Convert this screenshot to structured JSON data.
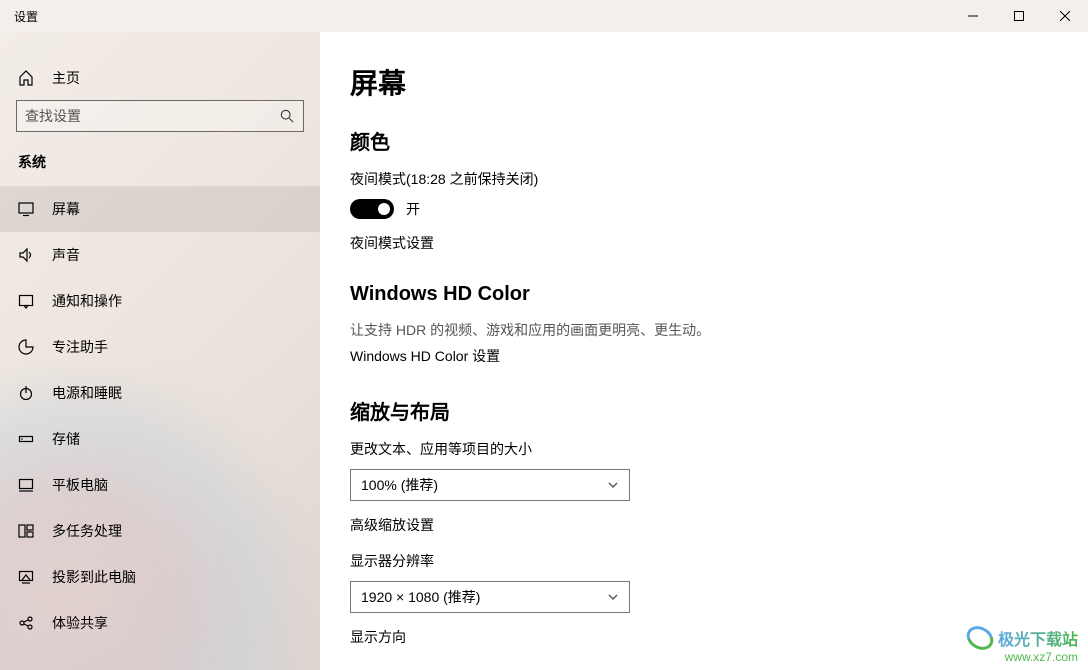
{
  "window": {
    "title": "设置"
  },
  "sidebar": {
    "home": "主页",
    "search_placeholder": "查找设置",
    "category": "系统",
    "items": [
      {
        "label": "屏幕"
      },
      {
        "label": "声音"
      },
      {
        "label": "通知和操作"
      },
      {
        "label": "专注助手"
      },
      {
        "label": "电源和睡眠"
      },
      {
        "label": "存储"
      },
      {
        "label": "平板电脑"
      },
      {
        "label": "多任务处理"
      },
      {
        "label": "投影到此电脑"
      },
      {
        "label": "体验共享"
      }
    ]
  },
  "content": {
    "page_title": "屏幕",
    "color": {
      "heading": "颜色",
      "night_mode_label": "夜间模式(18:28 之前保持关闭)",
      "toggle_state": "开",
      "night_mode_settings": "夜间模式设置"
    },
    "hdcolor": {
      "heading": "Windows HD Color",
      "desc": "让支持 HDR 的视频、游戏和应用的画面更明亮、更生动。",
      "link": "Windows HD Color 设置"
    },
    "scale": {
      "heading": "缩放与布局",
      "text_size_label": "更改文本、应用等项目的大小",
      "text_size_value": "100% (推荐)",
      "advanced": "高级缩放设置",
      "resolution_label": "显示器分辨率",
      "resolution_value": "1920 × 1080 (推荐)",
      "orientation_label": "显示方向"
    }
  },
  "watermark": {
    "name": "极光下载站",
    "url": "www.xz7.com"
  }
}
